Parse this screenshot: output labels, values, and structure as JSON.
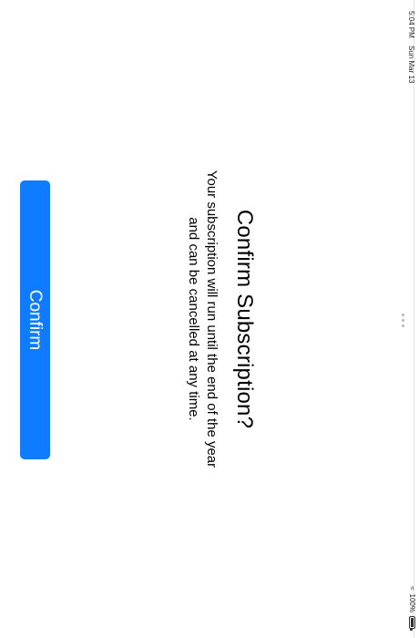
{
  "status_bar": {
    "time": "5:04 PM",
    "date": "Sun Mar 13",
    "battery_percent": "100%",
    "wifi_icon": "wifi-icon",
    "battery_icon": "battery-icon"
  },
  "sheet": {
    "grabber_icon": "ellipsis-icon",
    "title": "Confirm Subscription?",
    "message": "Your subscription will run until the end of the year and can be cancelled at any time.",
    "confirm_label": "Confirm",
    "accent_color": "#0f7cff"
  }
}
